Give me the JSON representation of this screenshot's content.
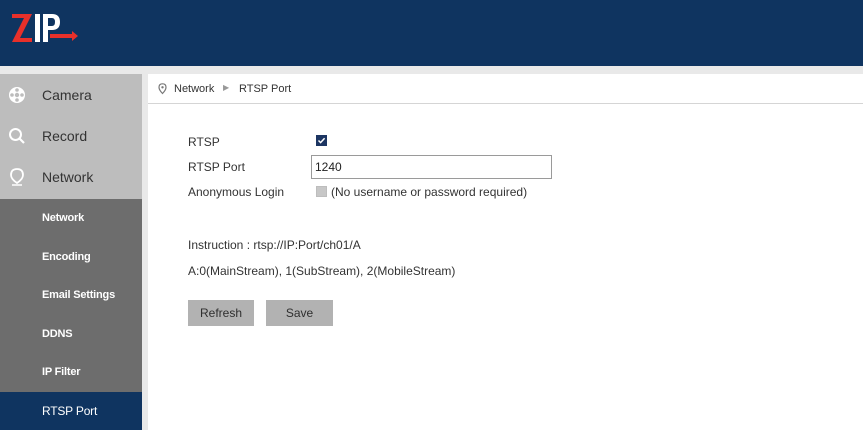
{
  "header": {
    "logo_text": "ZIP",
    "brand_color": "#0f3460",
    "logo_accent": "#e8302a"
  },
  "sidebar": {
    "main_items": [
      {
        "label": "Camera",
        "icon": "aperture-icon"
      },
      {
        "label": "Record",
        "icon": "search-icon"
      },
      {
        "label": "Network",
        "icon": "location-pin-icon"
      }
    ],
    "sub_items": [
      {
        "label": "Network"
      },
      {
        "label": "Encoding"
      },
      {
        "label": "Email Settings"
      },
      {
        "label": "DDNS"
      },
      {
        "label": "IP Filter"
      },
      {
        "label": "RTSP Port",
        "active": true
      }
    ]
  },
  "breadcrumb": {
    "icon": "location-pin-icon",
    "section": "Network",
    "page": "RTSP Port"
  },
  "form": {
    "rtsp_label": "RTSP",
    "rtsp_checked": true,
    "port_label": "RTSP Port",
    "port_value": "1240",
    "anon_label": "Anonymous Login",
    "anon_checked": false,
    "anon_note": "(No username or password required)"
  },
  "instructions": {
    "line1": "Instruction : rtsp://IP:Port/ch01/A",
    "line2": "A:0(MainStream), 1(SubStream), 2(MobileStream)"
  },
  "buttons": {
    "refresh": "Refresh",
    "save": "Save"
  }
}
